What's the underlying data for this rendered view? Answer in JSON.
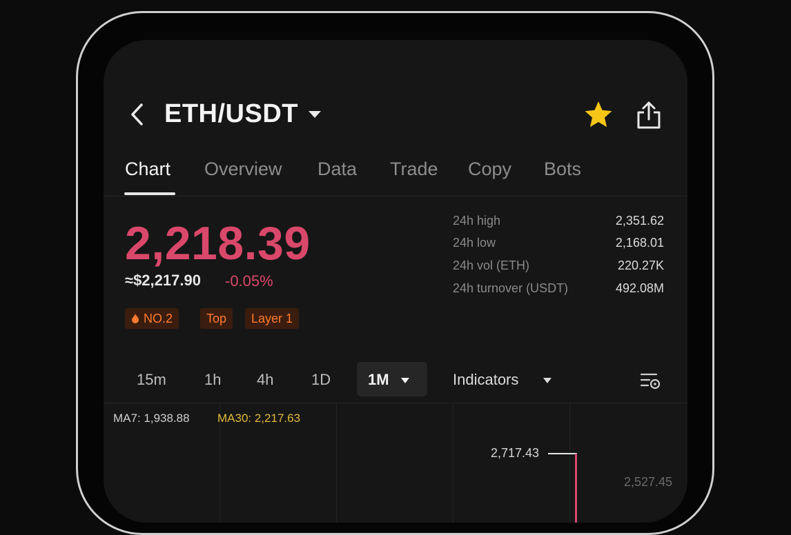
{
  "header": {
    "pair": "ETH/USDT",
    "back_icon": "chevron-left-icon",
    "dropdown_icon": "caret-down-icon",
    "favorite_icon": "star-icon",
    "share_icon": "share-icon"
  },
  "tabs": [
    {
      "label": "Chart",
      "active": true
    },
    {
      "label": "Overview"
    },
    {
      "label": "Data"
    },
    {
      "label": "Trade"
    },
    {
      "label": "Copy"
    },
    {
      "label": "Bots"
    }
  ],
  "price": {
    "last": "2,218.39",
    "approx_usd": "≈$2,217.90",
    "change_pct": "-0.05%"
  },
  "tags": [
    {
      "label": "NO.2",
      "icon": "flame-icon"
    },
    {
      "label": "Top"
    },
    {
      "label": "Layer 1"
    }
  ],
  "stats": [
    {
      "label": "24h high",
      "value": "2,351.62"
    },
    {
      "label": "24h low",
      "value": "2,168.01"
    },
    {
      "label": "24h vol (ETH)",
      "value": "220.27K"
    },
    {
      "label": "24h turnover (USDT)",
      "value": "492.08M"
    }
  ],
  "timeframes": {
    "options": [
      "15m",
      "1h",
      "4h",
      "1D"
    ],
    "selected": "1M",
    "indicators_label": "Indicators",
    "settings_icon": "chart-settings-icon"
  },
  "chart": {
    "ma7": "MA7: 1,938.88",
    "ma30": "MA30: 2,217.63",
    "high_marker": "2,717.43",
    "axis_label": "2,527.45"
  },
  "colors": {
    "down": "#d9486a",
    "accent_tag": "#ff7a2e",
    "star": "#f5c518",
    "ma30": "#e2b93b"
  }
}
